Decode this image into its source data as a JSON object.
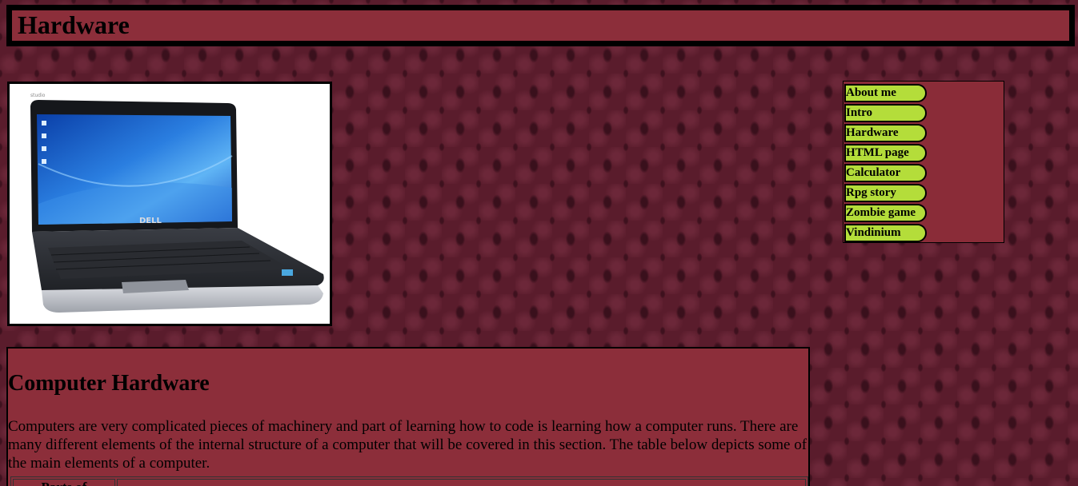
{
  "header": {
    "title": "Hardware"
  },
  "image": {
    "alt": "Dell laptop",
    "brand_text": "DELL",
    "model_text": "studio"
  },
  "nav": {
    "items": [
      {
        "label": "About me"
      },
      {
        "label": "Intro"
      },
      {
        "label": "Hardware"
      },
      {
        "label": "HTML page"
      },
      {
        "label": "Calculator"
      },
      {
        "label": "Rpg story"
      },
      {
        "label": "Zombie game"
      },
      {
        "label": "Vindinium"
      }
    ]
  },
  "content": {
    "heading": "Computer Hardware",
    "paragraph": "Computers are very complicated pieces of machinery and part of learning how to code is learning how a computer runs. There are many different elements of the internal structure of a computer that will be covered in this section. The table below depicts some of the main elements of a computer.",
    "table": {
      "headers": [
        "Parts of",
        ""
      ]
    }
  },
  "colors": {
    "panel": "#8c2e3a",
    "nav_button": "#b4dd3a",
    "border": "#000000"
  }
}
